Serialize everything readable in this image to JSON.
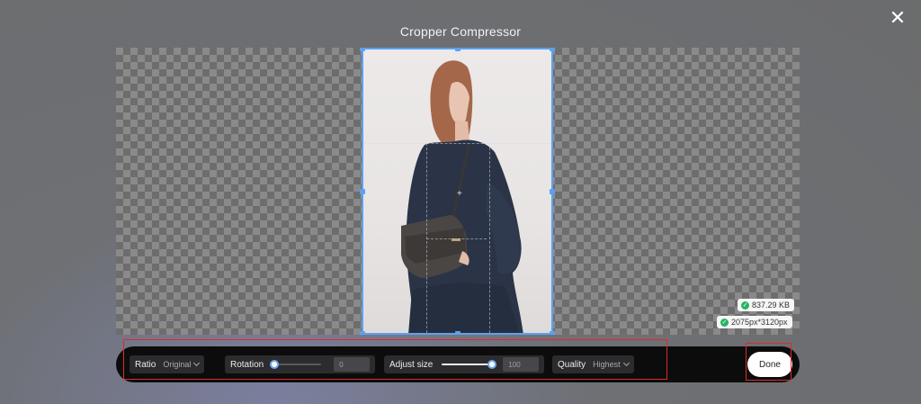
{
  "dialog": {
    "title": "Cropper Compressor",
    "close_icon": "close-icon"
  },
  "image_info": {
    "file_size": "837.29 KB",
    "dimensions": "2075px*3120px",
    "status_icon": "check-circle-icon",
    "status_color": "#26b561"
  },
  "toolbar": {
    "ratio": {
      "label": "Ratio",
      "value": "Original"
    },
    "rotation": {
      "label": "Rotation",
      "slider_value": 0,
      "input_value": "0"
    },
    "adjust_size": {
      "label": "Adjust size",
      "slider_value": 100,
      "input_value": "100"
    },
    "quality": {
      "label": "Quality",
      "value": "Highest"
    },
    "done_label": "Done"
  },
  "colors": {
    "accent": "#5aa2f0",
    "highlight_box": "#e02a2a",
    "toolbar_bg": "#0c0c0c"
  }
}
